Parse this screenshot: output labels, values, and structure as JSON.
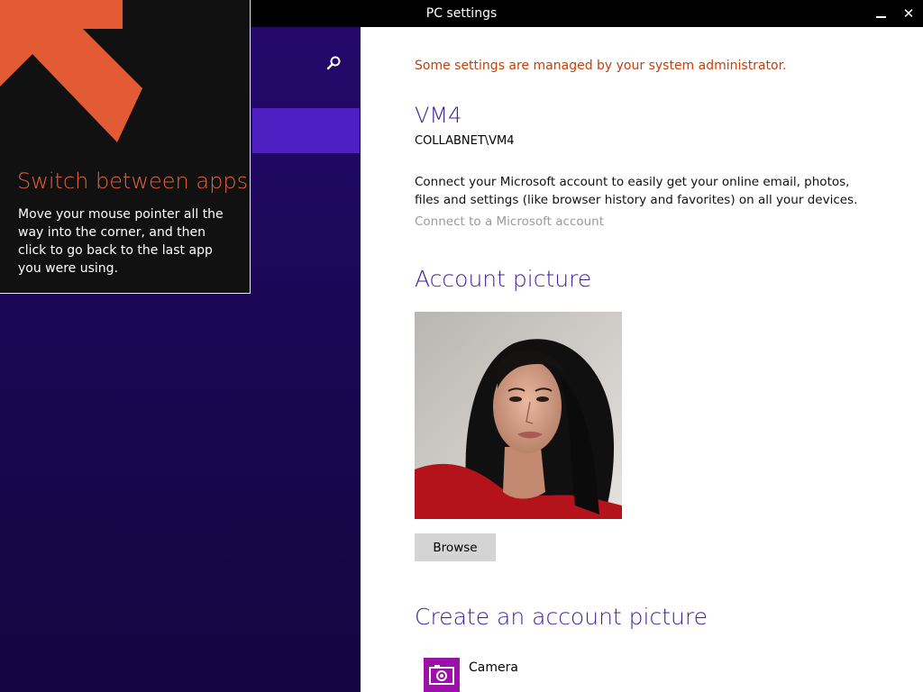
{
  "window": {
    "title": "PC settings",
    "minimize_label": "",
    "close_label": "✕"
  },
  "left_panel": {
    "search_icon": "search-icon",
    "selected_item_label": ""
  },
  "tip": {
    "title": "Switch between apps",
    "body": "Move your mouse pointer all the way into the corner, and then click to go back to the last app you were using.",
    "arrow_color": "#e35b35"
  },
  "content": {
    "admin_note": "Some settings are managed by your system administrator.",
    "user_name": "VM4",
    "user_domain": "COLLABNET\\VM4",
    "ms_account_desc": "Connect your Microsoft account to easily get your online email, photos, files and settings (like browser history and favorites) on all your devices.",
    "ms_account_link": "Connect to a Microsoft account",
    "account_picture_heading": "Account picture",
    "browse_label": "Browse",
    "create_heading": "Create an account picture",
    "camera_label": "Camera"
  },
  "colors": {
    "accent_purple": "#3f1f9a",
    "nav_bg": "#1b0754",
    "nav_selected": "#4e20c4",
    "warning": "#c2410c",
    "camera_tile": "#9b10a8"
  }
}
